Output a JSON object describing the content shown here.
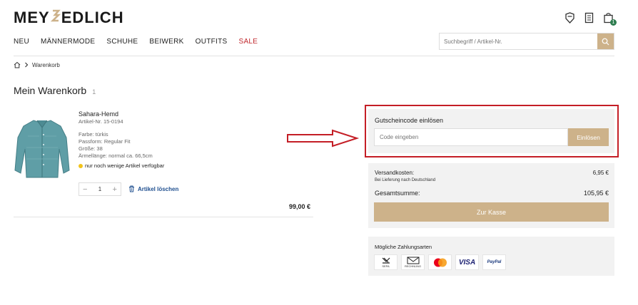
{
  "header": {
    "logo_left": "MEY",
    "logo_right": "EDLICH",
    "cart_count": "1"
  },
  "nav": {
    "items": [
      "NEU",
      "MÄNNERMODE",
      "SCHUHE",
      "BEIWERK",
      "OUTFITS"
    ],
    "sale": "SALE"
  },
  "search": {
    "placeholder": "Suchbegriff / Artikel-Nr."
  },
  "breadcrumb": {
    "current": "Warenkorb"
  },
  "cart": {
    "title": "Mein Warenkorb",
    "count": "1"
  },
  "item": {
    "name": "Sahara-Hemd",
    "article_no": "Artikel-Nr. 15-0194",
    "color": "Farbe: türkis",
    "fit": "Passform: Regular Fit",
    "size": "Größe: 38",
    "sleeve": "Ärmellänge: normal ca. 66,5cm",
    "availability": "nur noch wenige Artikel verfügbar",
    "quantity": "1",
    "delete_label": "Artikel löschen",
    "price": "99,00 €"
  },
  "voucher": {
    "label": "Gutscheincode einlösen",
    "placeholder": "Code eingeben",
    "button": "Einlösen"
  },
  "summary": {
    "shipping_label": "Versandkosten:",
    "shipping_note": "Bei Lieferung nach Deutschland",
    "shipping_value": "6,95 €",
    "total_label": "Gesamtsumme:",
    "total_value": "105,95 €",
    "checkout": "Zur Kasse"
  },
  "payments": {
    "label": "Mögliche Zahlungsarten",
    "sepa": "SEPA",
    "invoice": "RECHNUNG",
    "visa": "VISA",
    "paypal": "PayPal"
  },
  "colors": {
    "accent": "#cdb28a",
    "sale": "#c0282d",
    "highlight": "#c41e26",
    "link": "#1f4f8f",
    "panel": "#f2f2f2"
  }
}
